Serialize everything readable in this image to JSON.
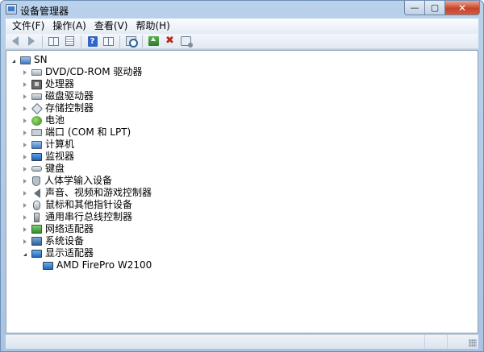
{
  "window": {
    "title": "设备管理器",
    "icon": "device-manager-icon"
  },
  "menu": [
    "文件(F)",
    "操作(A)",
    "查看(V)",
    "帮助(H)"
  ],
  "toolbar": [
    "back-icon",
    "forward-icon",
    "properties-icon",
    "view-icon",
    "help-icon",
    "scan-hardware-icon",
    "update-driver-icon",
    "uninstall-icon",
    "disable-icon"
  ],
  "tree": {
    "root": "SN",
    "categories": [
      {
        "label": "DVD/CD-ROM 驱动器",
        "icon": "dvd-drive-icon",
        "expanded": false
      },
      {
        "label": "处理器",
        "icon": "processor-icon",
        "expanded": false
      },
      {
        "label": "磁盘驱动器",
        "icon": "disk-drive-icon",
        "expanded": false
      },
      {
        "label": "存储控制器",
        "icon": "storage-controller-icon",
        "expanded": false
      },
      {
        "label": "电池",
        "icon": "battery-icon",
        "expanded": false
      },
      {
        "label": "端口 (COM 和 LPT)",
        "icon": "port-icon",
        "expanded": false
      },
      {
        "label": "计算机",
        "icon": "computer-icon",
        "expanded": false
      },
      {
        "label": "监视器",
        "icon": "monitor-icon",
        "expanded": false
      },
      {
        "label": "键盘",
        "icon": "keyboard-icon",
        "expanded": false
      },
      {
        "label": "人体学输入设备",
        "icon": "hid-icon",
        "expanded": false
      },
      {
        "label": "声音、视频和游戏控制器",
        "icon": "sound-icon",
        "expanded": false
      },
      {
        "label": "鼠标和其他指针设备",
        "icon": "mouse-icon",
        "expanded": false
      },
      {
        "label": "通用串行总线控制器",
        "icon": "usb-icon",
        "expanded": false
      },
      {
        "label": "网络适配器",
        "icon": "network-adapter-icon",
        "expanded": false
      },
      {
        "label": "系统设备",
        "icon": "system-device-icon",
        "expanded": false
      },
      {
        "label": "显示适配器",
        "icon": "display-adapter-icon",
        "expanded": true
      }
    ],
    "display_adapter_children": [
      "AMD FirePro W2100"
    ]
  },
  "colors": {
    "titlebar": "#b9d1ea",
    "close_button": "#c7432a",
    "content_bg": "#ffffff"
  }
}
